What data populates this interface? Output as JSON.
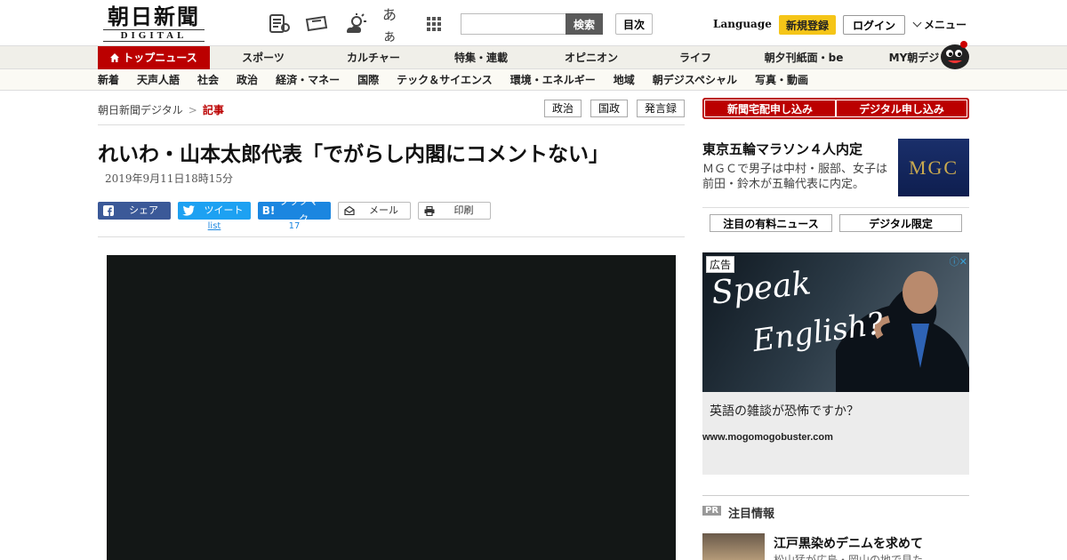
{
  "header": {
    "logo_main": "朝日新聞",
    "logo_sub": "DIGITAL",
    "icons": [
      "newspaper-icon",
      "coupon-icon",
      "weather-icon",
      "font-size-icon",
      "apps-grid-icon"
    ],
    "font_size_label": "あぁ",
    "search_placeholder": "",
    "search_button": "検索",
    "index_button": "目次",
    "language": "Language",
    "register": "新規登録",
    "login": "ログイン",
    "menu": "メニュー"
  },
  "nav1": {
    "items": [
      "トップニュース",
      "スポーツ",
      "カルチャー",
      "特集・連載",
      "オピニオン",
      "ライフ",
      "朝夕刊紙面・be",
      "MY朝デジ"
    ],
    "active_index": 0
  },
  "nav2": {
    "items": [
      "新着",
      "天声人語",
      "社会",
      "政治",
      "経済・マネー",
      "国際",
      "テック＆サイエンス",
      "環境・エネルギー",
      "地域",
      "朝デジスペシャル",
      "写真・動画"
    ]
  },
  "breadcrumb": {
    "home": "朝日新聞デジタル",
    "sep": ">",
    "current": "記事"
  },
  "tags": [
    "政治",
    "国政",
    "発言録"
  ],
  "article": {
    "headline": "れいわ・山本太郎代表「でがらし内閣にコメントない」",
    "date": "2019年9月11日18時15分"
  },
  "share": {
    "facebook": "シェア",
    "twitter": "ツイート",
    "twitter_count": "list",
    "hatena": "ブックマーク",
    "hatena_count": "17",
    "mail": "メール",
    "print": "印刷"
  },
  "sidebar": {
    "subscribe_paper": "新聞宅配申し込み",
    "subscribe_digital": "デジタル申し込み",
    "news_title": "東京五輪マラソン４人内定",
    "news_desc": "ＭＧＣで男子は中村・服部、女子は前田・鈴木が五輪代表に内定。",
    "news_thumb_text": "MGC",
    "tab_paid": "注目の有料ニュース",
    "tab_digital": "デジタル限定"
  },
  "ad": {
    "label": "広告",
    "close": "ⓘ✕",
    "headline_1": "Speak",
    "headline_2": "English?",
    "text": "英語の雑談が恐怖ですか？",
    "url": "www.mogomogobuster.com"
  },
  "pr": {
    "badge": "PR",
    "title": "注目情報",
    "item_title": "江戸黒染めデニムを求めて",
    "item_desc": "松山猛が広島・岡山の地で見た"
  },
  "colors": {
    "brand_red": "#bb0000",
    "register_yellow": "#f5c518",
    "facebook": "#3b5998",
    "twitter": "#1da1f2",
    "hatena": "#1b86e0"
  }
}
